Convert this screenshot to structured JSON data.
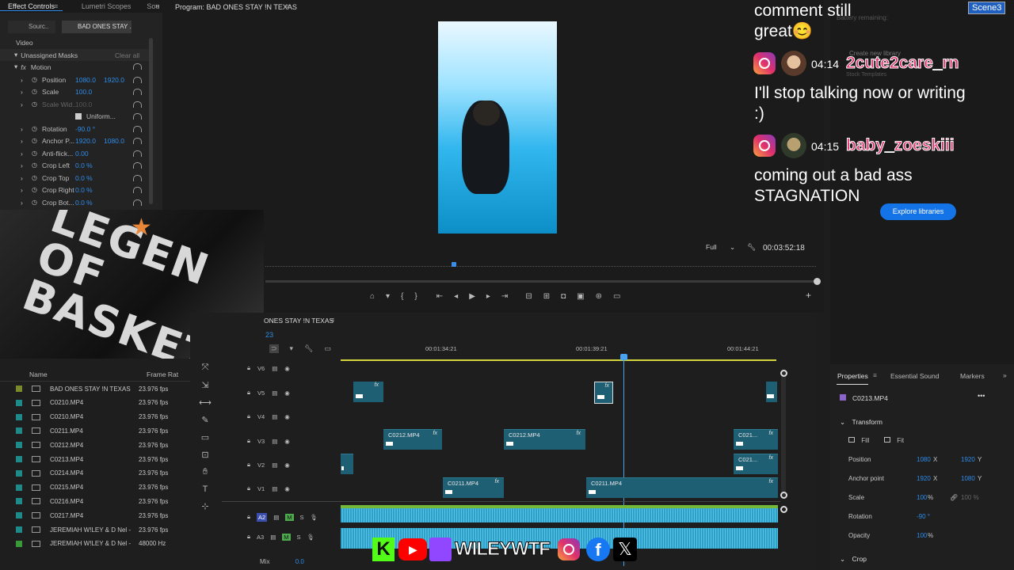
{
  "effect_controls": {
    "tabs": [
      "Effect Controls",
      "Lumetri Scopes",
      "Sou"
    ],
    "source_tab": "Sourc..",
    "clip_tab": "BAD ONES STAY ...",
    "section_video": "Video",
    "masks_label": "Unassigned Masks",
    "clear_all": "Clear all",
    "motion": "Motion",
    "rows": [
      {
        "label": "Position",
        "v1": "1080.0",
        "v2": "1920.0"
      },
      {
        "label": "Scale",
        "v1": "100.0",
        "v2": ""
      },
      {
        "label": "Scale Wid...",
        "v1": "100.0",
        "v2": ""
      },
      {
        "label": "Uniform...",
        "v1": "",
        "v2": ""
      },
      {
        "label": "Rotation",
        "v1": "-90.0 °",
        "v2": ""
      },
      {
        "label": "Anchor P...",
        "v1": "1920.0",
        "v2": "1080.0"
      },
      {
        "label": "Anti-flick...",
        "v1": "0.00",
        "v2": ""
      },
      {
        "label": "Crop Left",
        "v1": "0.0 %",
        "v2": ""
      },
      {
        "label": "Crop Top",
        "v1": "0.0 %",
        "v2": ""
      },
      {
        "label": "Crop Right",
        "v1": "0.0 %",
        "v2": ""
      },
      {
        "label": "Crop Bot...",
        "v1": "0.0 %",
        "v2": ""
      }
    ]
  },
  "program": {
    "title": "Program: BAD ONES STAY !N TEXAS",
    "zoom": "Full",
    "timecode": "00:03:52:18"
  },
  "webcam_shirt_text": "LEGEN OF BASKETB",
  "timeline": {
    "title": "ONES STAY !N TEXAS",
    "timecode_partial": "23",
    "ruler": [
      "00:01:34:21",
      "00:01:39:21",
      "00:01:44:21"
    ],
    "video_tracks": [
      "V6",
      "V5",
      "V4",
      "V3",
      "V2",
      "V1"
    ],
    "audio_tracks": [
      "A2",
      "A3"
    ],
    "mix_label": "Mix",
    "mix_value": "0.0",
    "clips": {
      "c_v3a": "C0212.MP4",
      "c_v3b": "C0212.MP4",
      "c_v3c": "C021...",
      "c_v2c": "C021...",
      "c_v1a": "C0211.MP4",
      "c_v1b": "C0211.MP4"
    }
  },
  "project": {
    "col_name": "Name",
    "col_rate": "Frame Rate",
    "items": [
      {
        "name": "BAD ONES STAY !N TEXAS",
        "rate": "23.976 fps",
        "color": "#7a8a2a"
      },
      {
        "name": "C0210.MP4",
        "rate": "23.976 fps",
        "color": "#1f8a8a"
      },
      {
        "name": "C0210.MP4",
        "rate": "23.976 fps",
        "color": "#1f8a8a"
      },
      {
        "name": "C0211.MP4",
        "rate": "23.976 fps",
        "color": "#1f8a8a"
      },
      {
        "name": "C0212.MP4",
        "rate": "23.976 fps",
        "color": "#1f8a8a"
      },
      {
        "name": "C0213.MP4",
        "rate": "23.976 fps",
        "color": "#1f8a8a"
      },
      {
        "name": "C0214.MP4",
        "rate": "23.976 fps",
        "color": "#1f8a8a"
      },
      {
        "name": "C0215.MP4",
        "rate": "23.976 fps",
        "color": "#1f8a8a"
      },
      {
        "name": "C0216.MP4",
        "rate": "23.976 fps",
        "color": "#1f8a8a"
      },
      {
        "name": "C0217.MP4",
        "rate": "23.976 fps",
        "color": "#1f8a8a"
      },
      {
        "name": "JEREMIAH W!LEY & D Nel -",
        "rate": "23.976 fps",
        "color": "#1f8a8a"
      },
      {
        "name": "JEREMIAH W!LEY & D Nel -",
        "rate": "48000 Hz",
        "color": "#3a9a3a"
      }
    ]
  },
  "chat": {
    "scene": "Scene3",
    "msg0_line1": "comment still",
    "msg0_line2": "great😊",
    "msg1_time": "04:14",
    "msg1_user": "2cute2care_rn",
    "msg1_line1": "I'll stop talking now or writing",
    "msg1_line2": ":)",
    "msg2_time": "04:15",
    "msg2_user": "baby_zoeskiii",
    "msg2_line1": "coming out a bad ass",
    "msg2_line2": "STAGNATION",
    "bg_text": [
      "Battery remaining:",
      "Create new library",
      "Stock Templates",
      "Explore libraries"
    ]
  },
  "properties": {
    "tabs": [
      "Properties",
      "Essential Sound",
      "Markers"
    ],
    "clip": "C0213.MP4",
    "transform": "Transform",
    "fill": "Fill",
    "fit": "Fit",
    "position": {
      "label": "Position",
      "x": "1080",
      "y": "1920"
    },
    "anchor": {
      "label": "Anchor point",
      "x": "1920",
      "y": "1080"
    },
    "scale": {
      "label": "Scale",
      "v": "100",
      "v2": "100 %"
    },
    "rotation": {
      "label": "Rotation",
      "v": "-90 °"
    },
    "opacity": {
      "label": "Opacity",
      "v": "100"
    },
    "crop": "Crop"
  },
  "overlay": {
    "handle": "WILEYWTF"
  }
}
